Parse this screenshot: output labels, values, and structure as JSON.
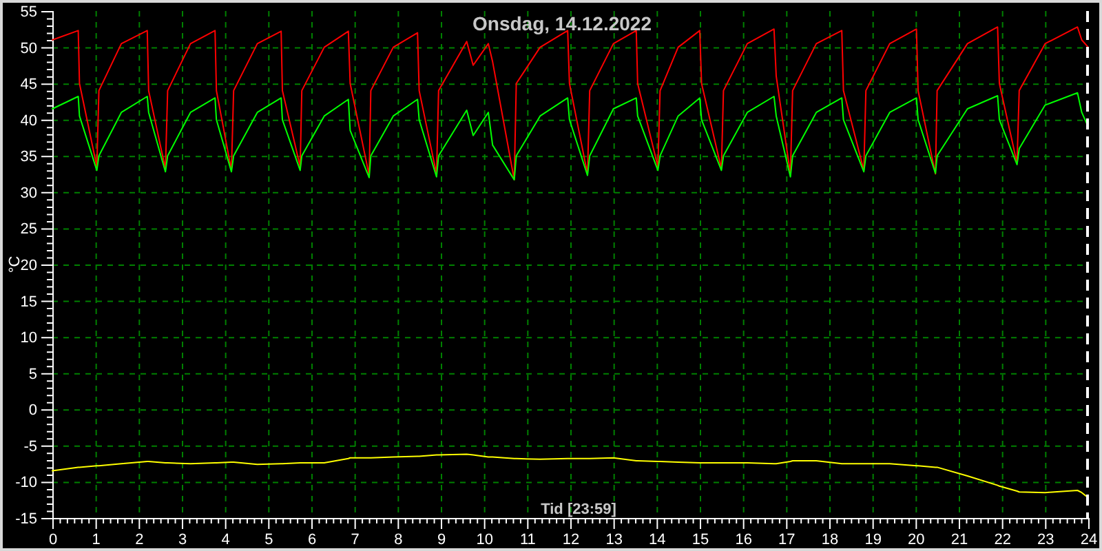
{
  "chart": {
    "chart_data": {
      "type": "line",
      "title": "Onsdag, 14.12.2022",
      "xlabel": "Tid [23:59]",
      "ylabel": "°C",
      "xlim": [
        0,
        24
      ],
      "ylim": [
        -15,
        55
      ],
      "xticks": [
        0,
        1,
        2,
        3,
        4,
        5,
        6,
        7,
        8,
        9,
        10,
        11,
        12,
        13,
        14,
        15,
        16,
        17,
        18,
        19,
        20,
        21,
        22,
        23,
        24
      ],
      "yticks": [
        -15,
        -10,
        -5,
        0,
        5,
        10,
        15,
        20,
        25,
        30,
        35,
        40,
        45,
        50,
        55
      ],
      "x": [
        0,
        0.6,
        0.63,
        1.03,
        1.08,
        1.6,
        2.2,
        2.23,
        2.62,
        2.67,
        3.2,
        3.77,
        3.8,
        4.15,
        4.2,
        4.75,
        5.3,
        5.33,
        5.74,
        5.78,
        6.3,
        6.86,
        6.9,
        7.34,
        7.38,
        7.9,
        8.46,
        8.5,
        8.9,
        8.95,
        9.6,
        9.75,
        10.1,
        10.2,
        10.7,
        10.75,
        11.3,
        11.94,
        11.98,
        12.4,
        12.45,
        13.0,
        13.53,
        13.56,
        14.03,
        14.08,
        14.5,
        15.0,
        15.04,
        15.5,
        15.55,
        16.1,
        16.72,
        16.77,
        17.1,
        17.15,
        17.7,
        18.29,
        18.33,
        18.8,
        18.85,
        19.4,
        20.02,
        20.06,
        20.46,
        20.5,
        21.2,
        21.9,
        21.94,
        22.35,
        22.4,
        23.0,
        23.75,
        23.85,
        24.0
      ],
      "series": [
        {
          "color": "#ff0000",
          "values": [
            51,
            52.3,
            45,
            33.5,
            44,
            50.5,
            52.3,
            44,
            33.2,
            44,
            50.5,
            52.3,
            44,
            33,
            44,
            50.5,
            52.2,
            44,
            33.5,
            44,
            50,
            52.2,
            45,
            32.3,
            44,
            50,
            52,
            44,
            32.5,
            44,
            50.8,
            47.5,
            50.5,
            48,
            31.7,
            45,
            50,
            52.3,
            45,
            32.5,
            44,
            50.5,
            52.3,
            45,
            33.5,
            44,
            50,
            52.3,
            45,
            33.2,
            44,
            50.5,
            52.5,
            46,
            32.5,
            44,
            50.5,
            52.3,
            44,
            33,
            44,
            50.5,
            52.5,
            44,
            32.5,
            44,
            50.5,
            52.8,
            45,
            34,
            44,
            50.5,
            52.8,
            51,
            50
          ]
        },
        {
          "color": "#00ff00",
          "values": [
            41.5,
            43.2,
            40.5,
            33,
            35,
            41,
            43.2,
            41,
            32.8,
            35,
            41,
            43,
            40,
            32.8,
            35,
            41,
            43,
            40,
            33,
            35,
            40.5,
            42.8,
            38.5,
            32,
            35,
            40.5,
            42.8,
            40,
            32.1,
            35,
            41.3,
            37.8,
            41,
            36.5,
            31.7,
            35,
            40.5,
            43,
            40,
            32.3,
            35,
            41.5,
            43,
            40.5,
            33,
            35,
            40.5,
            43,
            40,
            33,
            35,
            41,
            43.2,
            40.5,
            32.1,
            35,
            41,
            43,
            40,
            32.8,
            35,
            41,
            43,
            40,
            32.6,
            35,
            41.5,
            43.3,
            40,
            33.8,
            36,
            42,
            43.7,
            41,
            39
          ]
        },
        {
          "color": "#ffff00",
          "values": [
            -8.5,
            -8,
            -8,
            -7.8,
            -7.8,
            -7.5,
            -7.2,
            -7.2,
            -7.4,
            -7.4,
            -7.5,
            -7.4,
            -7.4,
            -7.3,
            -7.3,
            -7.6,
            -7.5,
            -7.5,
            -7.4,
            -7.4,
            -7.4,
            -6.8,
            -6.7,
            -6.7,
            -6.7,
            -6.6,
            -6.5,
            -6.5,
            -6.3,
            -6.3,
            -6.2,
            -6.3,
            -6.6,
            -6.6,
            -6.8,
            -6.8,
            -6.9,
            -6.8,
            -6.8,
            -6.8,
            -6.8,
            -6.7,
            -7.1,
            -7.1,
            -7.2,
            -7.2,
            -7.3,
            -7.4,
            -7.4,
            -7.4,
            -7.4,
            -7.4,
            -7.5,
            -7.5,
            -7.2,
            -7.1,
            -7.1,
            -7.5,
            -7.5,
            -7.5,
            -7.5,
            -7.5,
            -7.8,
            -7.8,
            -8,
            -8,
            -9.2,
            -10.5,
            -10.6,
            -11.3,
            -11.4,
            -11.5,
            -11.2,
            -11.5,
            -12.2
          ]
        }
      ],
      "grid": true,
      "ref_lines": [
        {
          "axis": "x",
          "value": 24
        }
      ]
    }
  }
}
